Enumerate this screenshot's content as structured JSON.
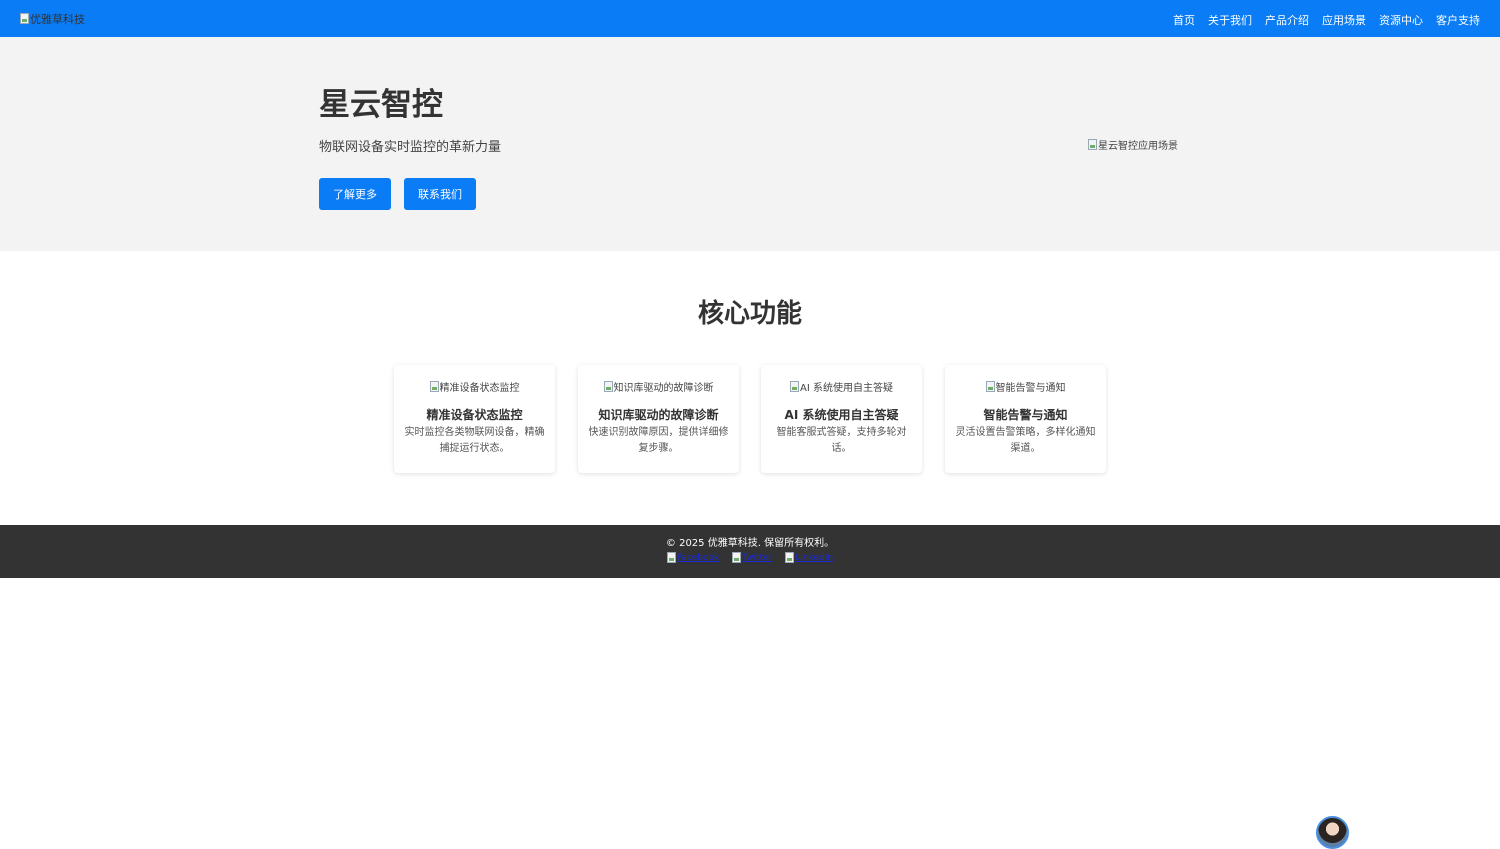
{
  "header": {
    "logo_alt": "优雅草科技",
    "nav": [
      "首页",
      "关于我们",
      "产品介绍",
      "应用场景",
      "资源中心",
      "客户支持"
    ]
  },
  "hero": {
    "title": "星云智控",
    "subtitle": "物联网设备实时监控的革新力量",
    "learn_more": "了解更多",
    "contact_us": "联系我们",
    "image_alt": "星云智控应用场景"
  },
  "features": {
    "title": "核心功能",
    "cards": [
      {
        "image_alt": "精准设备状态监控",
        "title": "精准设备状态监控",
        "desc": "实时监控各类物联网设备，精确捕捉运行状态。"
      },
      {
        "image_alt": "知识库驱动的故障诊断",
        "title": "知识库驱动的故障诊断",
        "desc": "快速识别故障原因，提供详细修复步骤。"
      },
      {
        "image_alt": "AI 系统使用自主答疑",
        "title": "AI 系统使用自主答疑",
        "desc": "智能客服式答疑，支持多轮对话。"
      },
      {
        "image_alt": "智能告警与通知",
        "title": "智能告警与通知",
        "desc": "灵活设置告警策略，多样化通知渠道。"
      }
    ]
  },
  "footer": {
    "copyright": "© 2025 优雅草科技. 保留所有权利。",
    "social": [
      "Facebook",
      "Twitter",
      "LinkedIn"
    ]
  },
  "colors": {
    "primary": "#0a7cf5",
    "hero_bg": "#f3f3f3",
    "footer_bg": "#333333"
  }
}
